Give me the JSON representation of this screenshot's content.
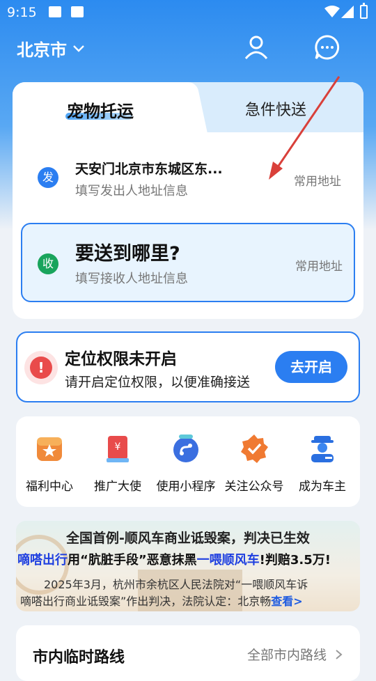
{
  "status": {
    "time": "9:15"
  },
  "header": {
    "city": "北京市"
  },
  "tabs": [
    {
      "label": "宠物托运",
      "active": true
    },
    {
      "label": "急件快送",
      "active": false
    }
  ],
  "sender": {
    "badge": "发",
    "title": "天安门北京市东城区东...",
    "subtitle": "填写发出人地址信息",
    "common": "常用地址"
  },
  "receiver": {
    "badge": "收",
    "title": "要送到哪里?",
    "subtitle": "填写接收人地址信息",
    "common": "常用地址"
  },
  "location_notice": {
    "title": "定位权限未开启",
    "subtitle": "请开启定位权限，以便准确接送",
    "button": "去开启"
  },
  "quick_actions": [
    {
      "label": "福利中心",
      "icon": "gift-icon"
    },
    {
      "label": "推广大使",
      "icon": "promo-icon"
    },
    {
      "label": "使用小程序",
      "icon": "mini-program-icon"
    },
    {
      "label": "关注公众号",
      "icon": "follow-badge-icon"
    },
    {
      "label": "成为车主",
      "icon": "driver-icon"
    }
  ],
  "news": {
    "line1": "全国首例-顺风车商业诋毁案，判决已生效",
    "line2_a": "嘀嗒出行",
    "line2_b": "用“肮脏手段”恶意抹黑",
    "line2_c": "一喂顺风车",
    "line2_d": "!判赔3.5万!",
    "line3": "2025年3月，杭州市余杭区人民法院对“一喂顺风车诉",
    "line4": "嘀嗒出行商业诋毁案”作出判决，法院认定：北京畅",
    "more": "查看>"
  },
  "route": {
    "title": "市内临时路线",
    "all": "全部市内路线"
  },
  "colors": {
    "primary": "#2b7ef1",
    "green": "#19a45c",
    "warn": "#e94b4b",
    "highlight": "#1e3fe0"
  }
}
